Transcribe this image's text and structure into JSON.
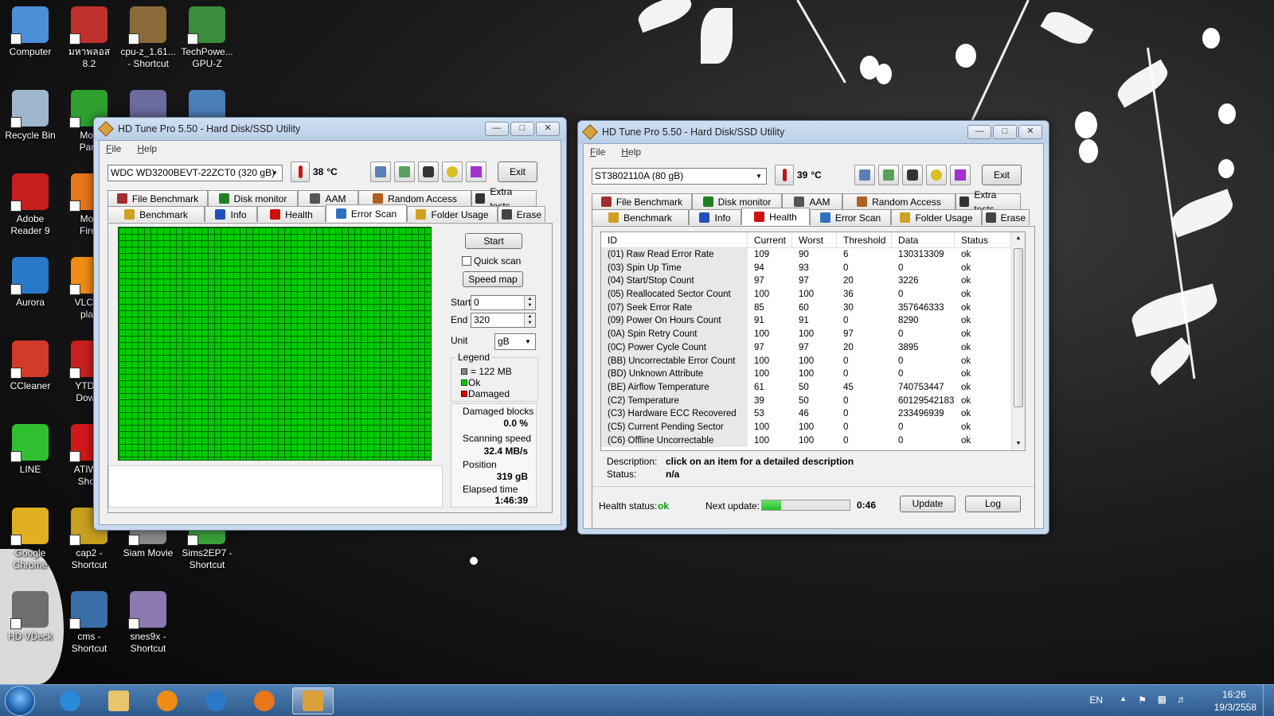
{
  "desktop": {
    "icons": [
      {
        "label": "Computer",
        "color": "#4a8fd8"
      },
      {
        "label": "มหาพลอส 8.2",
        "color": "#c0302c"
      },
      {
        "label": "cpu-z_1.61...\n- Shortcut",
        "color": "#8b6a3a"
      },
      {
        "label": "TechPowe...\nGPU-Z",
        "color": "#3b8c3b"
      },
      {
        "label": "Recycle Bin",
        "color": "#9fb6cc"
      },
      {
        "label": "Mob\nParti",
        "color": "#2da02d"
      },
      {
        "label": "",
        "color": "#6b6b9e"
      },
      {
        "label": "",
        "color": "#4b7fb8"
      },
      {
        "label": "Adobe\nReader 9",
        "color": "#c81e1e"
      },
      {
        "label": "Moz\nFiref",
        "color": "#e8761b"
      },
      {
        "label": "Aurora",
        "color": "#2a78c8"
      },
      {
        "label": "VLC m\nplay",
        "color": "#f08c14"
      },
      {
        "label": "CCleaner",
        "color": "#d23a2a"
      },
      {
        "label": "YTD V\nDownl",
        "color": "#c82020"
      },
      {
        "label": "LINE",
        "color": "#2fbf2f"
      },
      {
        "label": "ATIWin\nShort",
        "color": "#d01818"
      },
      {
        "label": "Google\nChrome",
        "color": "#e0b020"
      },
      {
        "label": "cap2 -\nShortcut",
        "color": "#c7a020"
      },
      {
        "label": "Siam Movie",
        "color": "#8a8a8a"
      },
      {
        "label": "Sims2EP7 -\nShortcut",
        "color": "#3aa03a"
      },
      {
        "label": "HD VDeck",
        "color": "#6e6e6e"
      },
      {
        "label": "cms -\nShortcut",
        "color": "#3a6ea8"
      },
      {
        "label": "snes9x -\nShortcut",
        "color": "#8a7ab0"
      }
    ]
  },
  "window_left": {
    "title": "HD Tune Pro 5.50 - Hard Disk/SSD Utility",
    "menu": [
      "File",
      "Help"
    ],
    "drive": "WDC WD3200BEVT-22ZCT0 (320 gB)",
    "temperature": "38",
    "temp_unit": "°C",
    "exit_label": "Exit",
    "tabs_row1": [
      "File Benchmark",
      "Disk monitor",
      "AAM",
      "Random Access",
      "Extra tests"
    ],
    "tabs_row2": [
      "Benchmark",
      "Info",
      "Health",
      "Error Scan",
      "Folder Usage",
      "Erase"
    ],
    "active_tab": "Error Scan",
    "start_label": "Start",
    "quick_scan_label": "Quick scan",
    "speed_map_label": "Speed map",
    "start_field_label": "Start",
    "start_value": "0",
    "end_field_label": "End",
    "end_value": "320",
    "unit_label": "Unit",
    "unit_value": "gB",
    "legend_title": "Legend",
    "legend_block": "= 122 MB",
    "legend_ok": "Ok",
    "legend_damaged": "Damaged",
    "damaged_blocks_label": "Damaged blocks",
    "damaged_blocks_value": "0.0 %",
    "scanning_speed_label": "Scanning speed",
    "scanning_speed_value": "32.4 MB/s",
    "position_label": "Position",
    "position_value": "319 gB",
    "elapsed_label": "Elapsed time",
    "elapsed_value": "1:46:39"
  },
  "window_right": {
    "title": "HD Tune Pro 5.50 - Hard Disk/SSD Utility",
    "menu": [
      "File",
      "Help"
    ],
    "drive": "ST3802110A (80 gB)",
    "temperature": "39",
    "temp_unit": "°C",
    "exit_label": "Exit",
    "tabs_row1": [
      "File Benchmark",
      "Disk monitor",
      "AAM",
      "Random Access",
      "Extra tests"
    ],
    "tabs_row2": [
      "Benchmark",
      "Info",
      "Health",
      "Error Scan",
      "Folder Usage",
      "Erase"
    ],
    "active_tab": "Health",
    "table_headers": [
      "ID",
      "Current",
      "Worst",
      "Threshold",
      "Data",
      "Status"
    ],
    "table_rows": [
      [
        "(01) Raw Read Error Rate",
        "109",
        "90",
        "6",
        "130313309",
        "ok"
      ],
      [
        "(03) Spin Up Time",
        "94",
        "93",
        "0",
        "0",
        "ok"
      ],
      [
        "(04) Start/Stop Count",
        "97",
        "97",
        "20",
        "3226",
        "ok"
      ],
      [
        "(05) Reallocated Sector Count",
        "100",
        "100",
        "36",
        "0",
        "ok"
      ],
      [
        "(07) Seek Error Rate",
        "85",
        "60",
        "30",
        "357646333",
        "ok"
      ],
      [
        "(09) Power On Hours Count",
        "91",
        "91",
        "0",
        "8290",
        "ok"
      ],
      [
        "(0A) Spin Retry Count",
        "100",
        "100",
        "97",
        "0",
        "ok"
      ],
      [
        "(0C) Power Cycle Count",
        "97",
        "97",
        "20",
        "3895",
        "ok"
      ],
      [
        "(BB) Uncorrectable Error Count",
        "100",
        "100",
        "0",
        "0",
        "ok"
      ],
      [
        "(BD) Unknown Attribute",
        "100",
        "100",
        "0",
        "0",
        "ok"
      ],
      [
        "(BE) Airflow Temperature",
        "61",
        "50",
        "45",
        "740753447",
        "ok"
      ],
      [
        "(C2) Temperature",
        "39",
        "50",
        "0",
        "60129542183",
        "ok"
      ],
      [
        "(C3) Hardware ECC Recovered",
        "53",
        "46",
        "0",
        "233496939",
        "ok"
      ],
      [
        "(C5) Current Pending Sector",
        "100",
        "100",
        "0",
        "0",
        "ok"
      ],
      [
        "(C6) Offline Uncorrectable",
        "100",
        "100",
        "0",
        "0",
        "ok"
      ]
    ],
    "description_label": "Description:",
    "description_value": "click on an item for a detailed description",
    "status_label": "Status:",
    "status_value": "n/a",
    "health_status_label": "Health status:",
    "health_status_value": "ok",
    "next_update_label": "Next update:",
    "next_update_progress": 0.22,
    "next_update_value": "0:46",
    "update_label": "Update",
    "log_label": "Log"
  },
  "taskbar": {
    "apps": [
      {
        "name": "internet-explorer",
        "color": "#2a8ad8"
      },
      {
        "name": "file-explorer",
        "color": "#e8c46a"
      },
      {
        "name": "media-player",
        "color": "#f08c14"
      },
      {
        "name": "aurora",
        "color": "#2a78c8"
      },
      {
        "name": "firefox",
        "color": "#e8761b"
      },
      {
        "name": "hd-tune",
        "color": "#d9a13b"
      }
    ],
    "language": "EN",
    "time": "16:26",
    "date": "19/3/2558"
  },
  "colors": {
    "ok_green": "#00cc00",
    "health_ok": "#00a000",
    "progress": "#22c222"
  }
}
